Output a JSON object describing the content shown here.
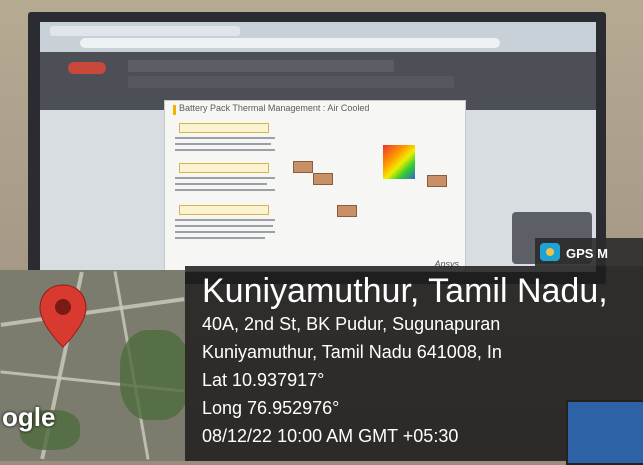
{
  "gps_app": {
    "label": "GPS M",
    "icon": "camera-globe-icon"
  },
  "map": {
    "provider_label": "ogle",
    "pin_icon": "map-pin-icon",
    "pin_color": "#d93a2f"
  },
  "location": {
    "title": "Kuniyamuthur, Tamil Nadu,",
    "address_line1": "40A, 2nd St, BK Pudur, Sugunapuran",
    "address_line2": "Kuniyamuthur, Tamil Nadu 641008, In",
    "lat": "Lat 10.937917°",
    "long": "Long 76.952976°",
    "timestamp": "08/12/22 10:00 AM GMT +05:30"
  },
  "screen": {
    "slide_title": "Battery Pack Thermal Management : Air Cooled",
    "brand": "Ansys"
  }
}
